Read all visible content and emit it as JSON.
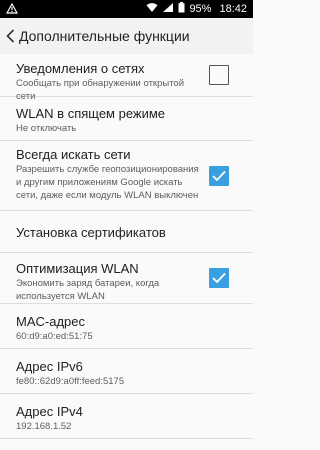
{
  "status_bar": {
    "battery_percent": "95%",
    "time": "18:42",
    "icons": [
      "warning-icon",
      "wifi-icon",
      "signal-icon",
      "battery-icon"
    ]
  },
  "app_bar": {
    "title": "Дополнительные функции"
  },
  "settings": [
    {
      "title": "Уведомления о сетях",
      "subtitle": "Сообщать при обнаружении открытой сети",
      "checkbox": true,
      "checked": false
    },
    {
      "title": "WLAN в спящем режиме",
      "subtitle": "Не отключать",
      "checkbox": false
    },
    {
      "title": "Всегда искать сети",
      "subtitle": "Разрешить службе геопозиционирования и другим приложениям Google искать сети, даже если модуль WLAN выключен",
      "checkbox": true,
      "checked": true
    },
    {
      "title": "Установка сертификатов",
      "subtitle": "",
      "checkbox": false
    },
    {
      "title": "Оптимизация WLAN",
      "subtitle": "Экономить заряд батареи, когда используется WLAN",
      "checkbox": true,
      "checked": true
    },
    {
      "title": "MAC-адрес",
      "subtitle": "60:d9:a0:ed:51:75",
      "checkbox": false
    },
    {
      "title": "Адрес IPv6",
      "subtitle": "fe80::62d9:a0ff:feed:5175",
      "checkbox": false
    },
    {
      "title": "Адрес IPv4",
      "subtitle": "192.168.1.52",
      "checkbox": false
    }
  ],
  "colors": {
    "accent": "#3a9fe0"
  }
}
